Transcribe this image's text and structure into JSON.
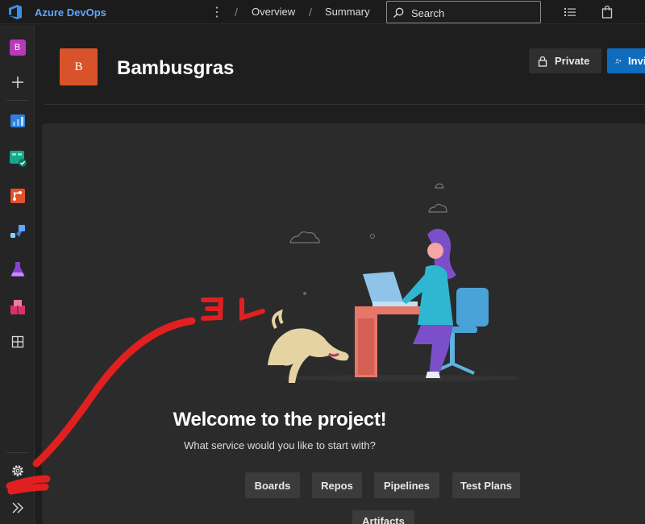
{
  "topbar": {
    "app_name": "Azure DevOps",
    "more_icon": "more-vertical-icon",
    "breadcrumb": [
      "Overview",
      "Summary"
    ],
    "breadcrumb_sep": "/",
    "search_placeholder": "Search",
    "icons": [
      "task-list-icon",
      "shopping-bag-icon"
    ]
  },
  "leftnav": {
    "project_initial": "B",
    "items": [
      {
        "name": "add",
        "icon": "plus-icon"
      },
      {
        "name": "overview",
        "icon": "overview-icon"
      },
      {
        "name": "boards",
        "icon": "boards-icon"
      },
      {
        "name": "repos",
        "icon": "repos-icon"
      },
      {
        "name": "pipelines",
        "icon": "pipelines-icon"
      },
      {
        "name": "test-plans",
        "icon": "test-plans-icon"
      },
      {
        "name": "artifacts",
        "icon": "artifacts-icon"
      },
      {
        "name": "extension",
        "icon": "grid-icon"
      }
    ],
    "bottom": [
      "gear-icon",
      "double-chevron-right-icon"
    ]
  },
  "header": {
    "avatar_initial": "B",
    "project_name": "Bambusgras",
    "private_label": "Private",
    "invite_label": "Invite"
  },
  "welcome": {
    "title": "Welcome to the project!",
    "subtitle": "What service would you like to start with?",
    "services": [
      "Boards",
      "Repos",
      "Pipelines",
      "Test Plans",
      "Artifacts"
    ]
  },
  "annotation": {
    "text": "コレ",
    "color": "#e02020"
  },
  "colors": {
    "accent": "#0f6cbd",
    "brand_text": "#5ea6ff",
    "avatar": "#d8532a",
    "project_badge": "#b83ab8"
  }
}
